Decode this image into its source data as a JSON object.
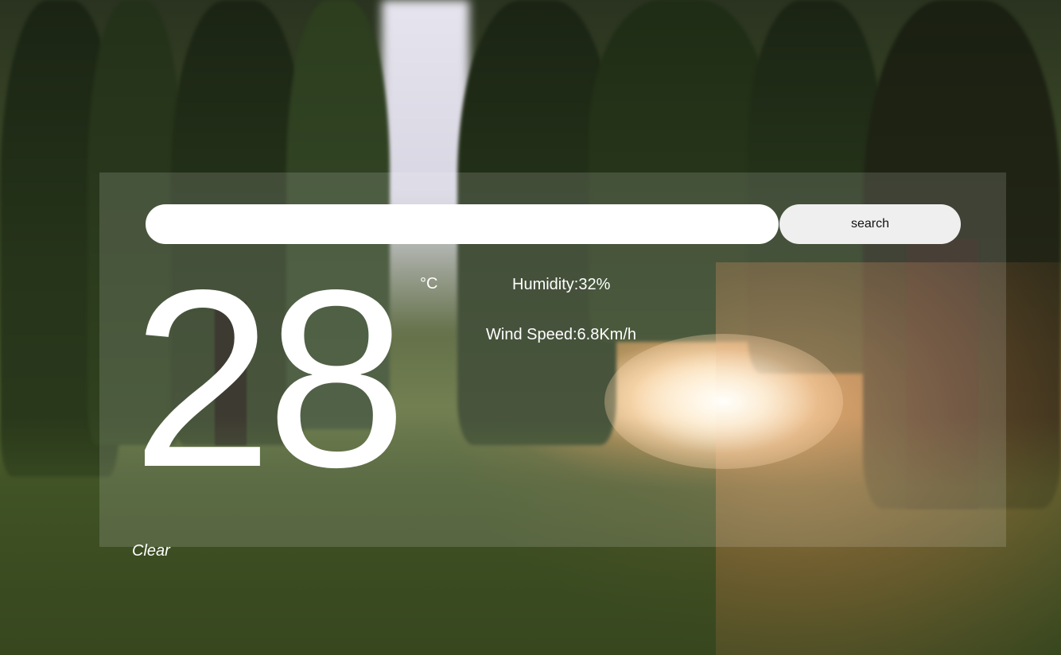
{
  "search": {
    "input_value": "",
    "input_placeholder": "",
    "button_label": "search"
  },
  "weather": {
    "temperature": "28",
    "unit": "°C",
    "humidity": "Humidity:32%",
    "wind_speed": "Wind Speed:6.8Km/h",
    "condition": "Clear"
  },
  "colors": {
    "panel_overlay": "#ffffff24",
    "text": "#ffffff",
    "input_background": "#ffffff",
    "button_background": "#efefef"
  },
  "background": {
    "description_icon": "forest-sunset-background"
  }
}
